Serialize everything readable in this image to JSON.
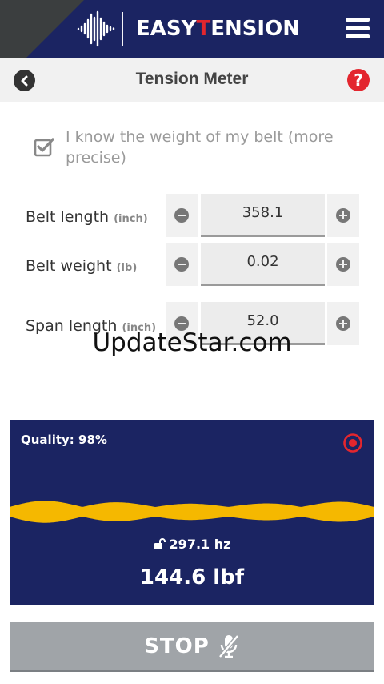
{
  "header": {
    "brand_part1": "EASY",
    "brand_accent": "T",
    "brand_part2": "ENSION",
    "brand_color": "#1b2462",
    "accent_color": "#e3262e"
  },
  "titlebar": {
    "title": "Tension Meter",
    "back_icon": "back-arrow-icon",
    "help_icon": "help-icon"
  },
  "know_weight": {
    "label": "I know the weight of my belt (more precise)",
    "checked": true
  },
  "fields": [
    {
      "label": "Belt length",
      "unit": "(inch)",
      "value": "358.1"
    },
    {
      "label": "Belt weight",
      "unit": "(lb)",
      "value": "0.02"
    },
    {
      "label": "Span length",
      "unit": "(inch)",
      "value": "52.0"
    }
  ],
  "watermark": "UpdateStar.com",
  "meter": {
    "quality": "Quality: 98%",
    "frequency": "297.1 hz",
    "tension": "144.6 lbf",
    "wave_color": "#f5b800",
    "record_icon": "record-icon"
  },
  "stop_button": {
    "label": "STOP",
    "icon": "microphone-off-icon"
  }
}
